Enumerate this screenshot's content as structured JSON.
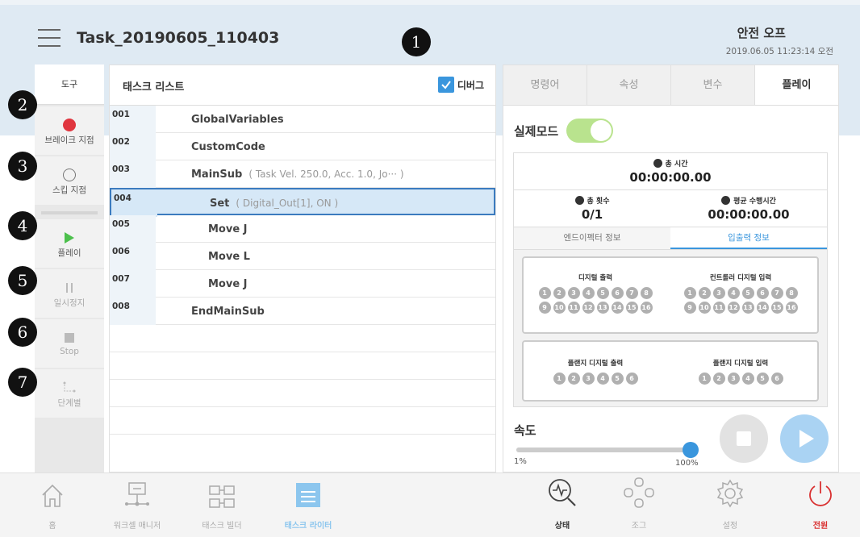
{
  "header": {
    "task_title": "Task_20190605_110403",
    "safety_status": "안전 오프",
    "datetime": "2019.06.05 11:23:14 오전"
  },
  "markers": [
    "1",
    "2",
    "3",
    "4",
    "5",
    "6",
    "7"
  ],
  "tools": {
    "title": "도구",
    "breakpoint": "브레이크 지점",
    "skip": "스킵 지점",
    "play": "플레이",
    "pause": "일시정지",
    "stop": "Stop",
    "step": "단계별"
  },
  "tasklist": {
    "title": "태스크 리스트",
    "debug_label": "디버그",
    "rows": [
      {
        "num": "001",
        "cmd": "GlobalVariables",
        "param": ""
      },
      {
        "num": "002",
        "cmd": "CustomCode",
        "param": ""
      },
      {
        "num": "003",
        "cmd": "MainSub",
        "param": "( Task Vel. 250.0, Acc. 1.0, Jo··· )"
      },
      {
        "num": "004",
        "cmd": "Set",
        "param": "( Digital_Out[1], ON )"
      },
      {
        "num": "005",
        "cmd": "Move J",
        "param": ""
      },
      {
        "num": "006",
        "cmd": "Move L",
        "param": ""
      },
      {
        "num": "007",
        "cmd": "Move J",
        "param": ""
      },
      {
        "num": "008",
        "cmd": "EndMainSub",
        "param": ""
      }
    ]
  },
  "tabs": [
    "명령어",
    "속성",
    "변수",
    "플레이"
  ],
  "play": {
    "real_mode": "실제모드",
    "total_time_label": "총 시간",
    "total_time": "00:00:00.00",
    "total_count_label": "총 횟수",
    "total_count": "0/1",
    "avg_time_label": "평균 수행시간",
    "avg_time": "00:00:00.00",
    "subtab_effector": "엔드이펙터 정보",
    "subtab_io": "입출력 정보",
    "digital_out": "디지털 출력",
    "controller_digital_in": "컨트롤러 디지털 입력",
    "flange_digital_out": "플랜지 디지털 출력",
    "flange_digital_in": "플랜지 디지털 입력",
    "speed_label": "속도",
    "speed_min": "1%",
    "speed_max": "100%",
    "speed_value": 100,
    "real_mode_on": true
  },
  "nav": {
    "home": "홈",
    "workcell": "워크셀 매니저",
    "taskbuilder": "태스크 빌더",
    "taskwriter": "태스크 라이터",
    "status": "상태",
    "jog": "조그",
    "settings": "설정",
    "power": "전원"
  },
  "colors": {
    "accent": "#3a96dd",
    "header_bg": "#dfeaf3",
    "toggle_on": "#b9e38e",
    "breakpoint": "#e0363f",
    "play_green": "#4cc04c",
    "power_red": "#d93030"
  }
}
